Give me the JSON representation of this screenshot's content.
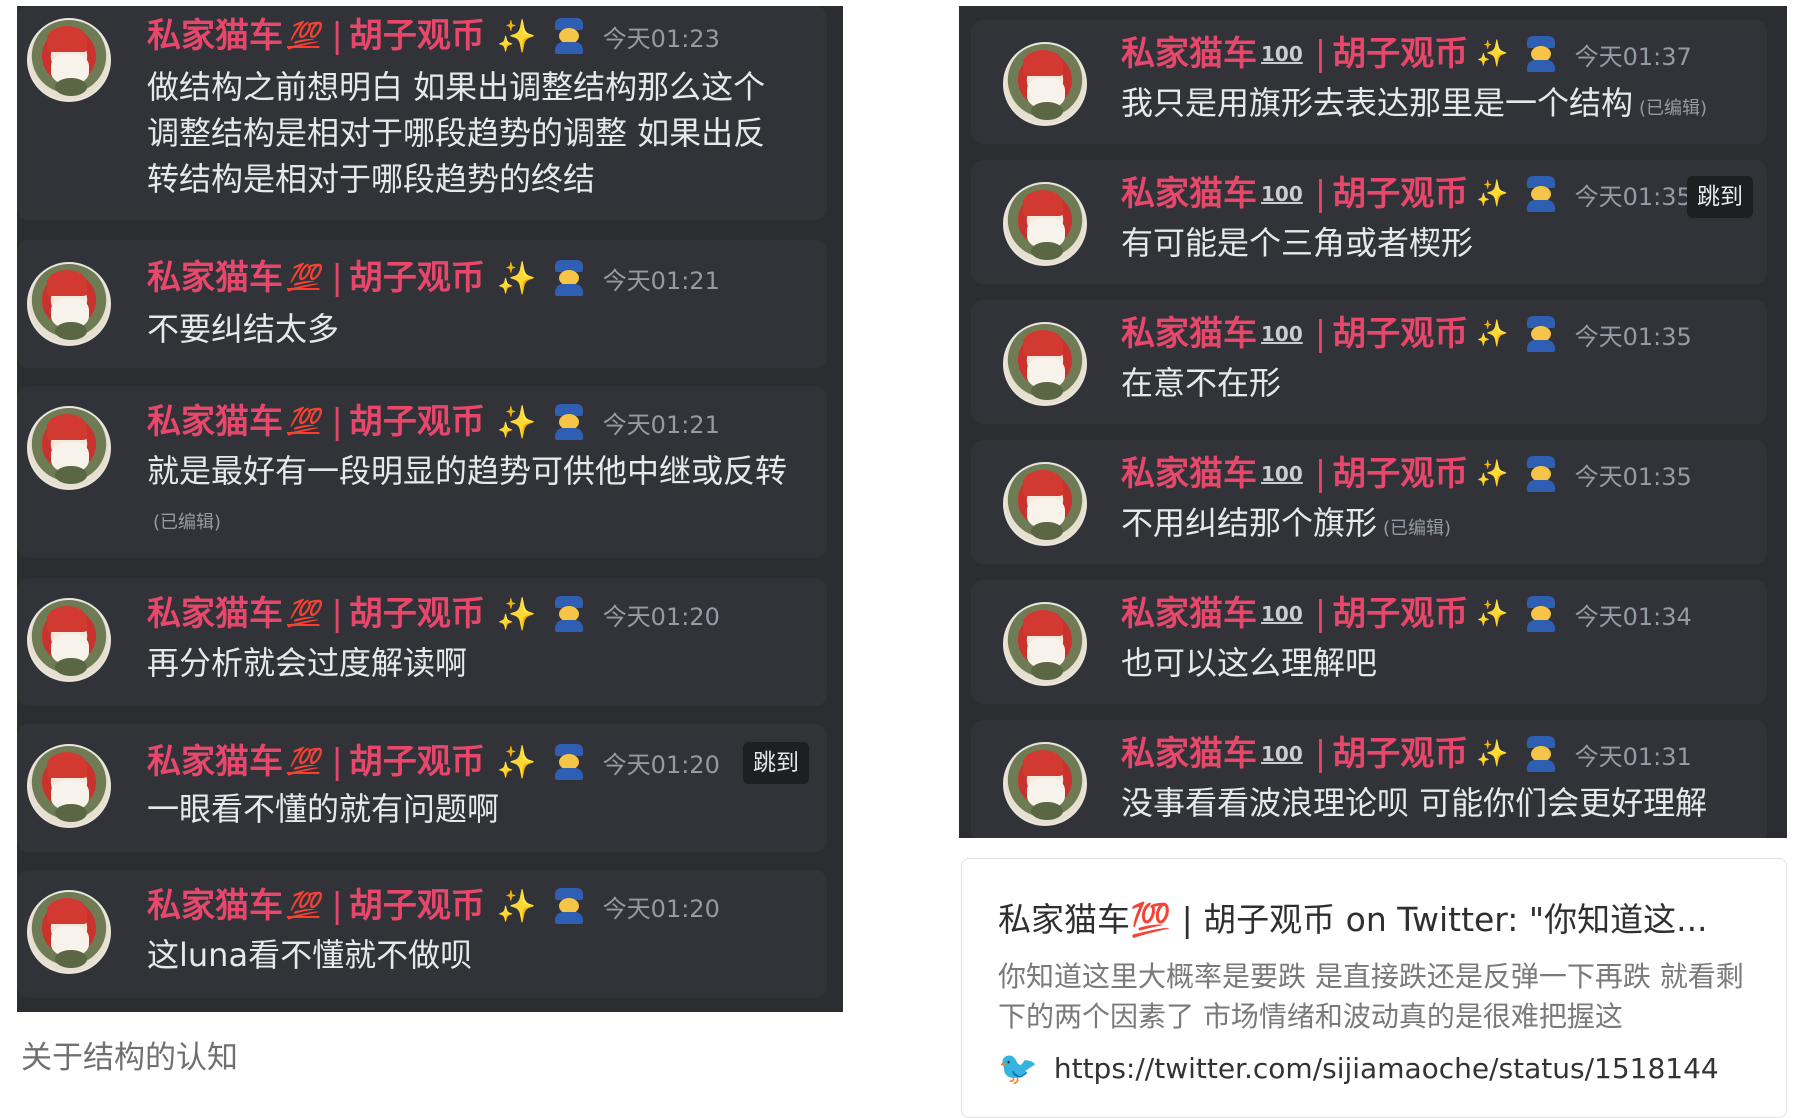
{
  "left_panel": {
    "messages": [
      {
        "name": "私家猫车",
        "emoji": "💯",
        "sep": "|",
        "handle": "胡子观币",
        "time": "今天01:23",
        "text": "做结构之前想明白 如果出调整结构那么这个调整结构是相对于哪段趋势的调整 如果出反转结构是相对于哪段趋势的终结",
        "edited": "",
        "jump": ""
      },
      {
        "name": "私家猫车",
        "emoji": "💯",
        "sep": "|",
        "handle": "胡子观币",
        "time": "今天01:21",
        "text": "不要纠结太多",
        "edited": "",
        "jump": ""
      },
      {
        "name": "私家猫车",
        "emoji": "💯",
        "sep": "|",
        "handle": "胡子观币",
        "time": "今天01:21",
        "text": "就是最好有一段明显的趋势可供他中继或反转",
        "edited": "(已编辑)",
        "jump": ""
      },
      {
        "name": "私家猫车",
        "emoji": "💯",
        "sep": "|",
        "handle": "胡子观币",
        "time": "今天01:20",
        "text": "再分析就会过度解读啊",
        "edited": "",
        "jump": ""
      },
      {
        "name": "私家猫车",
        "emoji": "💯",
        "sep": "|",
        "handle": "胡子观币",
        "time": "今天01:20",
        "text": "一眼看不懂的就有问题啊",
        "edited": "",
        "jump": "跳到"
      },
      {
        "name": "私家猫车",
        "emoji": "💯",
        "sep": "|",
        "handle": "胡子观币",
        "time": "今天01:20",
        "text": "这luna看不懂就不做呗",
        "edited": "",
        "jump": ""
      }
    ]
  },
  "right_panel": {
    "messages": [
      {
        "name": "私家猫车",
        "emoji": "100",
        "sep": "|",
        "handle": "胡子观币",
        "time": "今天01:37",
        "text": "我只是用旗形去表达那里是一个结构",
        "edited": "(已编辑)",
        "jump": ""
      },
      {
        "name": "私家猫车",
        "emoji": "100",
        "sep": "|",
        "handle": "胡子观币",
        "time": "今天01:35",
        "text": "有可能是个三角或者楔形",
        "edited": "",
        "jump": "跳到"
      },
      {
        "name": "私家猫车",
        "emoji": "100",
        "sep": "|",
        "handle": "胡子观币",
        "time": "今天01:35",
        "text": "在意不在形",
        "edited": "",
        "jump": ""
      },
      {
        "name": "私家猫车",
        "emoji": "100",
        "sep": "|",
        "handle": "胡子观币",
        "time": "今天01:35",
        "text": "不用纠结那个旗形",
        "edited": "(已编辑)",
        "jump": ""
      },
      {
        "name": "私家猫车",
        "emoji": "100",
        "sep": "|",
        "handle": "胡子观币",
        "time": "今天01:34",
        "text": "也可以这么理解吧",
        "edited": "",
        "jump": ""
      },
      {
        "name": "私家猫车",
        "emoji": "100",
        "sep": "|",
        "handle": "胡子观币",
        "time": "今天01:31",
        "text": "没事看看波浪理论呗 可能你们会更好理解",
        "edited": "",
        "jump": ""
      }
    ]
  },
  "caption": "关于结构的认知",
  "card": {
    "title": "私家猫车💯 | 胡子观币 on Twitter: \"你知道这...",
    "description": "你知道这里大概率是要跌 是直接跌还是反弹一下再跌 就看剩下的两个因素了 市场情绪和波动真的是很难把握这",
    "link": "https://twitter.com/sijiamaoche/status/1518144",
    "icon": "twitter-icon"
  },
  "colors": {
    "name": "#e8476b",
    "panel_bg": "#2b2d31",
    "message_bg": "#313338",
    "text": "#e6e8ea",
    "time": "#949ba4"
  }
}
